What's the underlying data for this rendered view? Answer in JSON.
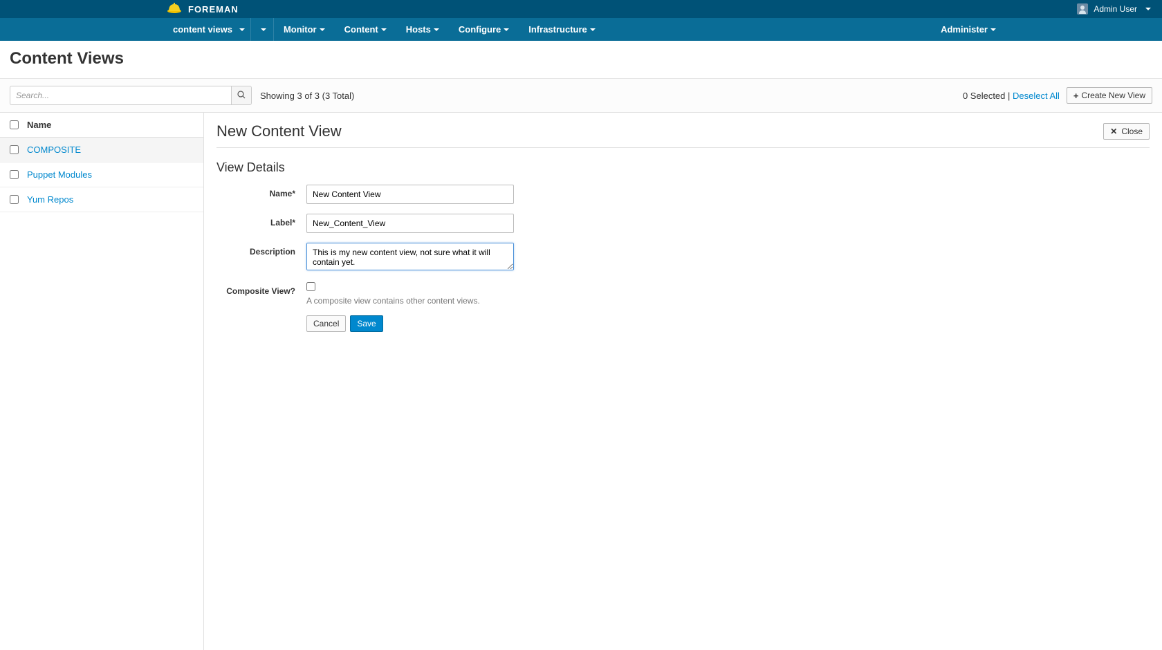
{
  "brand": {
    "name": "FOREMAN",
    "user": "Admin User"
  },
  "nav": {
    "context_label": "content views",
    "items": [
      "Monitor",
      "Content",
      "Hosts",
      "Configure",
      "Infrastructure"
    ],
    "right": "Administer"
  },
  "page": {
    "title": "Content Views"
  },
  "toolbar": {
    "search_placeholder": "Search...",
    "showing": "Showing 3 of 3 (3 Total)",
    "selected": "0 Selected",
    "pipe": " | ",
    "deselect": "Deselect All",
    "create": "Create New View"
  },
  "sidebar": {
    "header": "Name",
    "items": [
      {
        "label": "COMPOSITE",
        "selected": true
      },
      {
        "label": "Puppet Modules",
        "selected": false
      },
      {
        "label": "Yum Repos",
        "selected": false
      }
    ]
  },
  "content": {
    "title": "New Content View",
    "close": "Close",
    "section": "View Details",
    "form": {
      "name_label": "Name*",
      "name_value": "New Content View",
      "label_label": "Label*",
      "label_value": "New_Content_View",
      "desc_label": "Description",
      "desc_value": "This is my new content view, not sure what it will contain yet.",
      "composite_label": "Composite View?",
      "composite_help": "A composite view contains other content views.",
      "cancel": "Cancel",
      "save": "Save"
    }
  }
}
